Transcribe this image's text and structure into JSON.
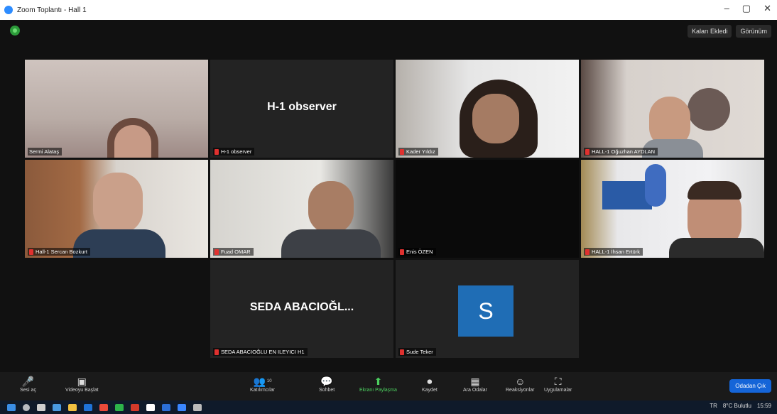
{
  "window": {
    "title": "Zoom Toplantı - Hall 1",
    "minimize": "–",
    "maximize": "▢",
    "close": "✕"
  },
  "top_buttons": {
    "view_left": "Kaları Ekledi",
    "view_right": "Görünüm"
  },
  "tiles": [
    {
      "name": "Sermi Alataş",
      "type": "video"
    },
    {
      "name": "H-1 observer",
      "type": "name",
      "big": "H-1 observer"
    },
    {
      "name": "Kader Yıldız",
      "type": "video"
    },
    {
      "name": "HALL-1 Oğuzhan AYDLAN",
      "type": "video"
    },
    {
      "name": "Hall-1 Sercan Bozkurt",
      "type": "video"
    },
    {
      "name": "Fuad OMAR",
      "type": "video"
    },
    {
      "name": "Enis ÖZEN",
      "type": "video"
    },
    {
      "name": "HALL-1 İhsan Ertürk",
      "type": "video"
    },
    {
      "name": "SEDA ABACIOĞLU EN ILEYICI H1",
      "type": "name",
      "big": "SEDA ABACIOĞL..."
    },
    {
      "name": "Sude Teker",
      "type": "avatar",
      "initial": "S"
    }
  ],
  "toolbar": {
    "mute": "Sesi aç",
    "video": "Videoyu Başlat",
    "participants": "Katılımcılar",
    "participants_count": "10",
    "chat": "Sohbet",
    "share": "Ekranı Paylaşma",
    "record": "Kaydet",
    "breakout": "Ara Odalar",
    "reactions": "Reaksiyonlar",
    "apps": "Uygulamalar",
    "leave": "Odadan Çık"
  },
  "taskbar": {
    "lang": "TR",
    "weather": "8°C Bulutlu",
    "time": "15:59"
  },
  "colors": {
    "active_border": "#b8e04a",
    "share_green": "#4ccf5f",
    "leave_blue": "#1565d8",
    "avatar_blue": "#1f6db5",
    "muted_red": "#e0312f"
  }
}
